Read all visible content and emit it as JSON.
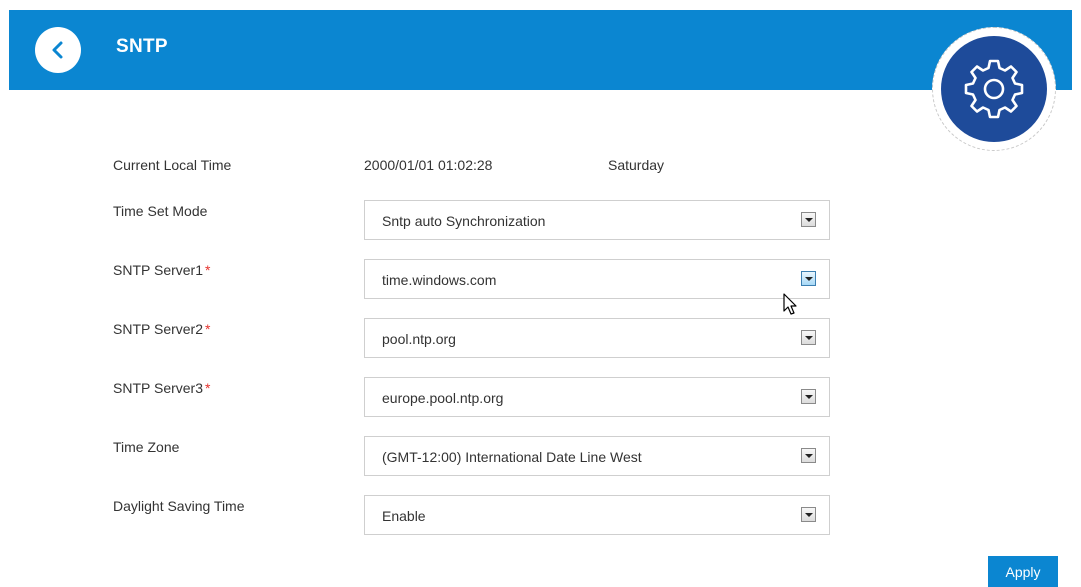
{
  "header": {
    "title": "SNTP",
    "back_icon": "chevron-left-icon",
    "settings_icon": "gear-icon",
    "color": "#0b86d1",
    "gear_disc_color": "#1e4b9a"
  },
  "current_time": {
    "label": "Current Local Time",
    "datetime": "2000/01/01 01:02:28",
    "weekday": "Saturday"
  },
  "fields": {
    "time_set_mode": {
      "label": "Time Set Mode",
      "value": "Sntp auto Synchronization"
    },
    "sntp_server1": {
      "label": "SNTP Server1",
      "required_mark": "*",
      "value": "time.windows.com"
    },
    "sntp_server2": {
      "label": "SNTP Server2",
      "required_mark": "*",
      "value": "pool.ntp.org"
    },
    "sntp_server3": {
      "label": "SNTP Server3",
      "required_mark": "*",
      "value": "europe.pool.ntp.org"
    },
    "time_zone": {
      "label": "Time Zone",
      "value": "(GMT-12:00) International Date Line West"
    },
    "daylight_saving": {
      "label": "Daylight Saving Time",
      "value": "Enable"
    }
  },
  "actions": {
    "apply_label": "Apply",
    "accent_color": "#0b86d1",
    "required_color": "#e5322d"
  }
}
